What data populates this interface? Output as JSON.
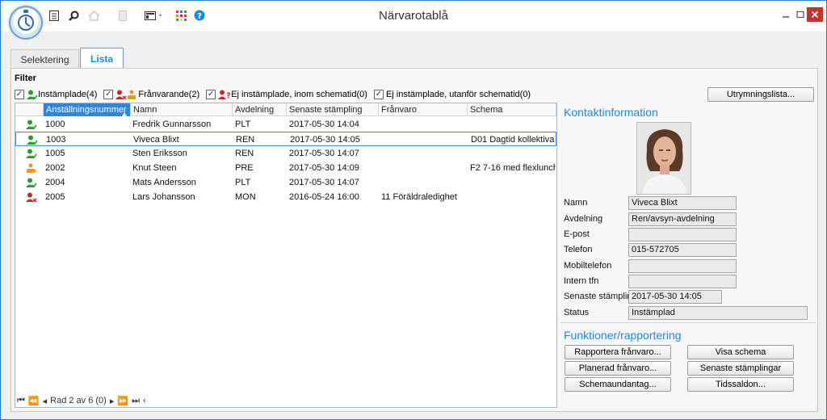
{
  "window": {
    "title": "Närvarotablå"
  },
  "tabs": [
    {
      "label": "Selektering"
    },
    {
      "label": "Lista"
    }
  ],
  "filter": {
    "label": "Filter",
    "items": [
      {
        "label": "Instämplade(4)",
        "checked": true
      },
      {
        "label": "Frånvarande(2)",
        "checked": true
      },
      {
        "label": "Ej instämplade, inom schematid(0)",
        "checked": true
      },
      {
        "label": "Ej instämplade, utanför schematid(0)",
        "checked": true
      }
    ]
  },
  "evacuation_button": "Utrymningslista...",
  "grid": {
    "columns": [
      "Anställningsnummer",
      "Namn",
      "Avdelning",
      "Senaste stämpling",
      "Frånvaro",
      "Schema"
    ],
    "rows": [
      {
        "status": "in",
        "nr": "1000",
        "name": "Fredrik Gunnarsson",
        "dept": "PLT",
        "stamp": "2017-05-30 14:04",
        "absence": "",
        "schedule": ""
      },
      {
        "status": "in",
        "nr": "1003",
        "name": "Viveca Blixt",
        "dept": "REN",
        "stamp": "2017-05-30 14:05",
        "absence": "",
        "schedule": "D01 Dagtid kollektiva"
      },
      {
        "status": "in",
        "nr": "1005",
        "name": "Sten Eriksson",
        "dept": "REN",
        "stamp": "2017-05-30 14:07",
        "absence": "",
        "schedule": ""
      },
      {
        "status": "coffee",
        "nr": "2002",
        "name": "Knut Steen",
        "dept": "PRE",
        "stamp": "2017-05-30 14:09",
        "absence": "",
        "schedule": "F2 7-16 med flexlunch"
      },
      {
        "status": "in",
        "nr": "2004",
        "name": "Mats Andersson",
        "dept": "PLT",
        "stamp": "2017-05-30 14:07",
        "absence": "",
        "schedule": ""
      },
      {
        "status": "absent",
        "nr": "2005",
        "name": "Lars Johansson",
        "dept": "MON",
        "stamp": "2016-05-24 16:00",
        "absence": "11 Föräldraledighet",
        "schedule": ""
      }
    ],
    "selected_row": 1,
    "pager_text": "Rad 2 av 6 (0)"
  },
  "contact": {
    "title": "Kontaktinformation",
    "fields": [
      {
        "label": "Namn",
        "value": "Viveca Blixt"
      },
      {
        "label": "Avdelning",
        "value": "Ren/avsyn-avdelning"
      },
      {
        "label": "E-post",
        "value": ""
      },
      {
        "label": "Telefon",
        "value": "015-572705"
      },
      {
        "label": "Mobiltelefon",
        "value": ""
      },
      {
        "label": "Intern tfn",
        "value": ""
      },
      {
        "label": "Senaste stämpling",
        "value": "2017-05-30 14:05"
      },
      {
        "label": "Status",
        "value": "Instämplad"
      }
    ]
  },
  "functions": {
    "title": "Funktioner/rapportering",
    "buttons": [
      "Rapportera frånvaro...",
      "Visa schema",
      "Planerad frånvaro...",
      "Senaste stämplingar",
      "Schemaundantag...",
      "Tidssaldon..."
    ]
  },
  "colors": {
    "accent": "#1e88e5",
    "in": "#2e9b2e",
    "absent": "#c62828",
    "coffee": "#e39b1b",
    "close": "#c8312b"
  }
}
